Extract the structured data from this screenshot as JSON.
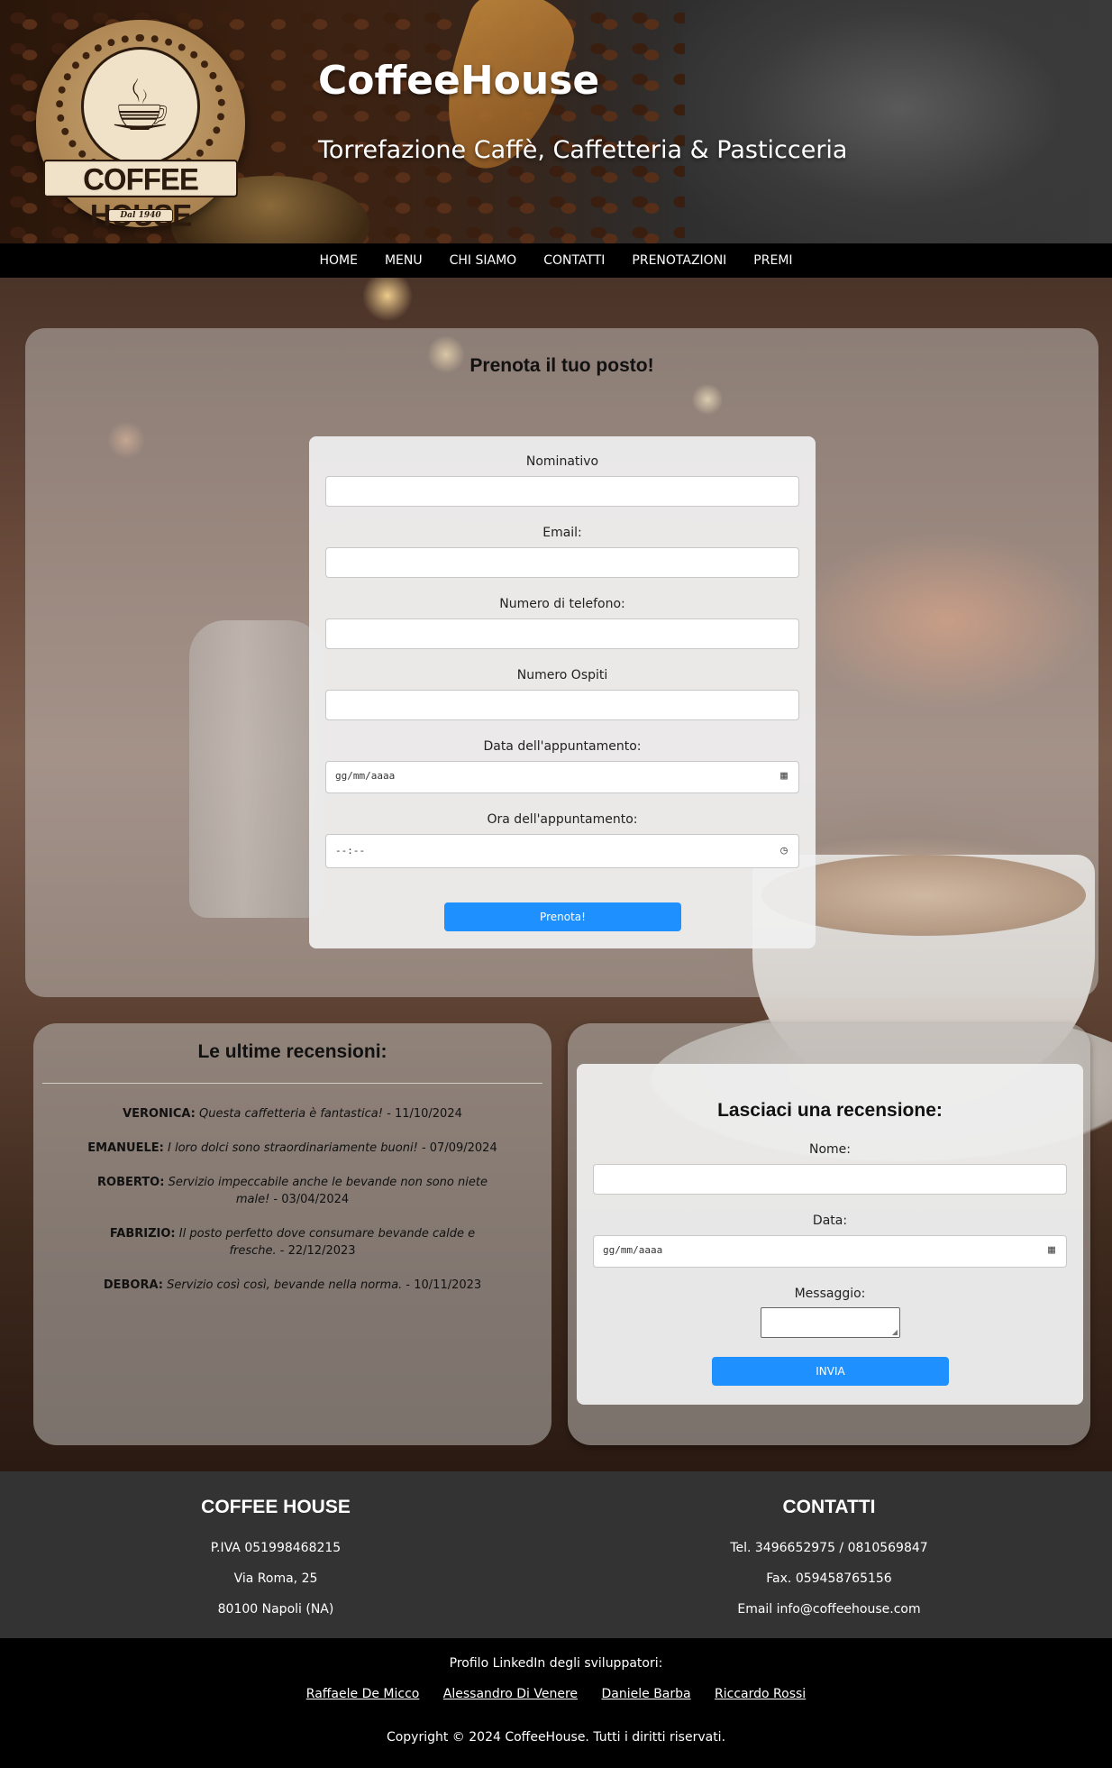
{
  "header": {
    "title": "CoffeeHouse",
    "subtitle": "Torrefazione Caffè, Caffetteria & Pasticceria",
    "logo_text": "COFFEE HOUSE",
    "logo_since": "Dal 1940"
  },
  "nav": {
    "items": [
      "HOME",
      "MENU",
      "CHI SIAMO",
      "CONTATTI",
      "PRENOTAZIONI",
      "PREMI"
    ]
  },
  "booking": {
    "title": "Prenota il tuo posto!",
    "fields": {
      "name_label": "Nominativo",
      "email_label": "Email:",
      "phone_label": "Numero di telefono:",
      "guests_label": "Numero Ospiti",
      "date_label": "Data dell'appuntamento:",
      "date_placeholder": "gg/mm/aaaa",
      "time_label": "Ora dell'appuntamento:",
      "time_placeholder": "--:--"
    },
    "submit_label": "Prenota!"
  },
  "reviews": {
    "title": "Le ultime recensioni:",
    "items": [
      {
        "author": "VERONICA:",
        "text": "Questa caffetteria è fantastica!",
        "date": " - 11/10/2024"
      },
      {
        "author": "EMANUELE:",
        "text": "I loro dolci sono straordinariamente buoni!",
        "date": " - 07/09/2024"
      },
      {
        "author": "ROBERTO:",
        "text": "Servizio impeccabile anche le bevande non sono niete male!",
        "date": " - 03/04/2024"
      },
      {
        "author": "FABRIZIO:",
        "text": "Il posto perfetto dove consumare bevande calde e fresche.",
        "date": " - 22/12/2023"
      },
      {
        "author": "DEBORA:",
        "text": "Servizio così così, bevande nella norma.",
        "date": " - 10/11/2023"
      }
    ]
  },
  "leave_review": {
    "title": "Lasciaci una recensione:",
    "name_label": "Nome:",
    "date_label": "Data:",
    "date_placeholder": "gg/mm/aaaa",
    "message_label": "Messaggio:",
    "submit_label": "INVIA"
  },
  "footer": {
    "company": {
      "title": "COFFEE HOUSE",
      "vat": "P.IVA 051998468215",
      "address": "Via Roma, 25",
      "city": "80100 Napoli (NA)"
    },
    "contacts": {
      "title": "CONTATTI",
      "phone": "Tel. 3496652975 / 0810569847",
      "fax": "Fax. 059458765156",
      "email": "Email info@coffeehouse.com"
    },
    "devs_label": "Profilo LinkedIn degli sviluppatori:",
    "devs": [
      "Raffaele De Micco",
      "Alessandro Di Venere",
      "Daniele Barba",
      "Riccardo Rossi"
    ],
    "copyright": "Copyright © 2024 CoffeeHouse. Tutti i diritti riservati."
  },
  "colors": {
    "accent": "#1e90ff",
    "nav_bg": "#000000",
    "footer_bg": "#333333"
  },
  "icons": {
    "calendar": "calendar-icon",
    "clock": "clock-icon"
  }
}
